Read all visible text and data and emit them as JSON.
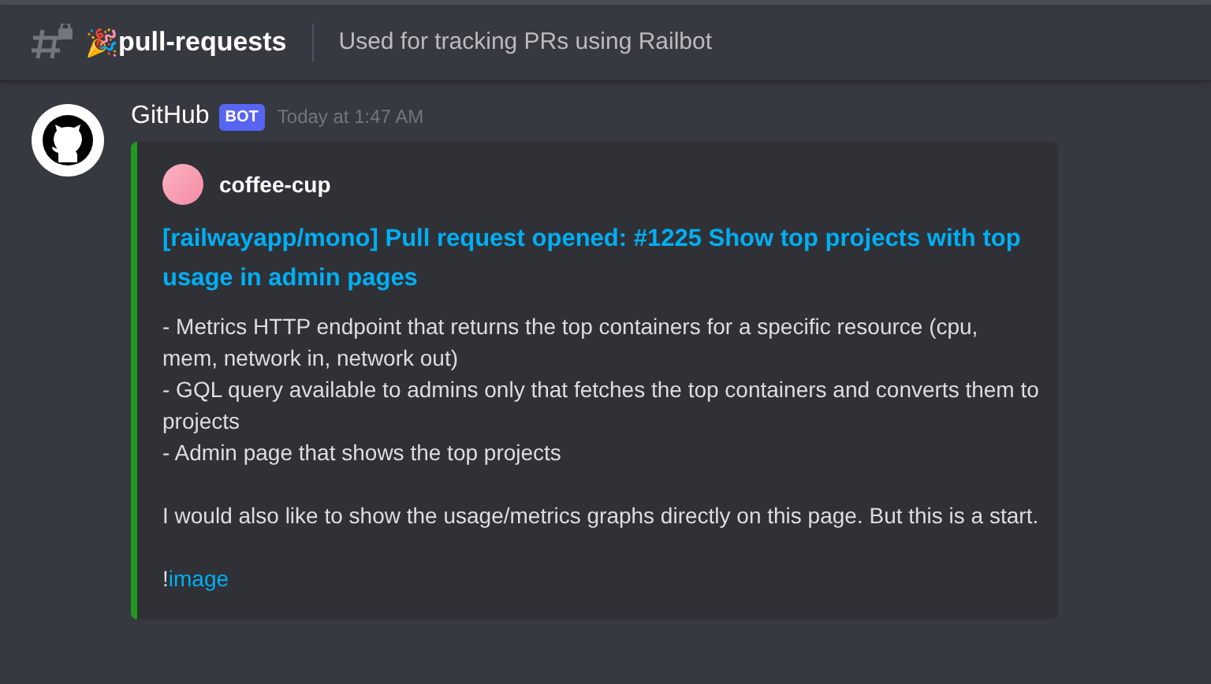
{
  "channel": {
    "emoji": "🎉",
    "name": "pull-requests",
    "topic": "Used for tracking PRs using Railbot"
  },
  "message": {
    "author": "GitHub",
    "badge": "BOT",
    "timestamp": "Today at 1:47 AM",
    "embed": {
      "color": "#1f9b1f",
      "author": "coffee-cup",
      "title": "[railwayapp/mono] Pull request opened: #1225 Show top projects with top usage in admin pages",
      "paragraphs": [
        {
          "lines": [
            "- Metrics HTTP endpoint that returns the top containers for a specific resource (cpu, mem, network in, network out)",
            "- GQL query available to admins only that fetches the top containers and converts them to projects",
            "- Admin page that shows the top projects"
          ]
        },
        {
          "lines": [
            "I would also like to show the usage/metrics graphs directly on this page. But this is a start."
          ]
        }
      ],
      "footer": {
        "prefix": "!",
        "link": "image"
      }
    }
  }
}
